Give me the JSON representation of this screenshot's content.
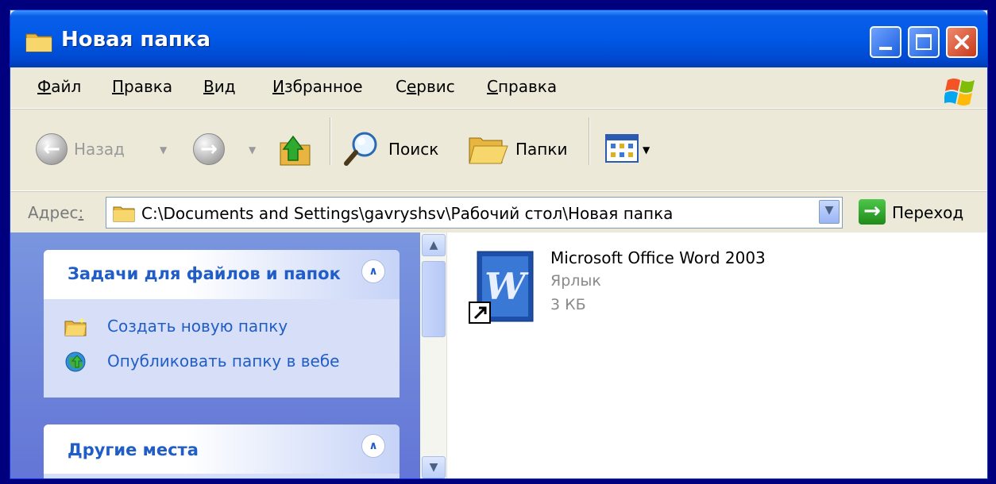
{
  "window": {
    "title": "Новая папка"
  },
  "menubar": {
    "items": [
      {
        "underlined": "Ф",
        "rest": "айл"
      },
      {
        "underlined": "П",
        "rest": "равка"
      },
      {
        "underlined": "В",
        "rest": "ид"
      },
      {
        "underlined": "И",
        "rest": "збранное"
      },
      {
        "pre": "С",
        "underlined": "е",
        "rest": "рвис"
      },
      {
        "underlined": "С",
        "rest": "правка"
      }
    ]
  },
  "toolbar": {
    "back_label": "Назад",
    "search_label": "Поиск",
    "folders_label": "Папки"
  },
  "address": {
    "label_pre": "Адрес",
    "label_accel": ":",
    "path": "C:\\Documents and Settings\\gavryshsv\\Рабочий стол\\Новая папка",
    "go_label": "Переход"
  },
  "tasks_panel": {
    "title": "Задачи для файлов и папок",
    "items": [
      "Создать новую папку",
      "Опубликовать папку в вебе"
    ]
  },
  "places_panel": {
    "title": "Другие места"
  },
  "file": {
    "name": "Microsoft Office Word 2003",
    "type": "Ярлык",
    "size": "3 КБ"
  },
  "colors": {
    "titlebar": "#0058e6",
    "link": "#215dc6",
    "panel_bg": "#d6dff7",
    "left_pane": "#6e84da"
  }
}
